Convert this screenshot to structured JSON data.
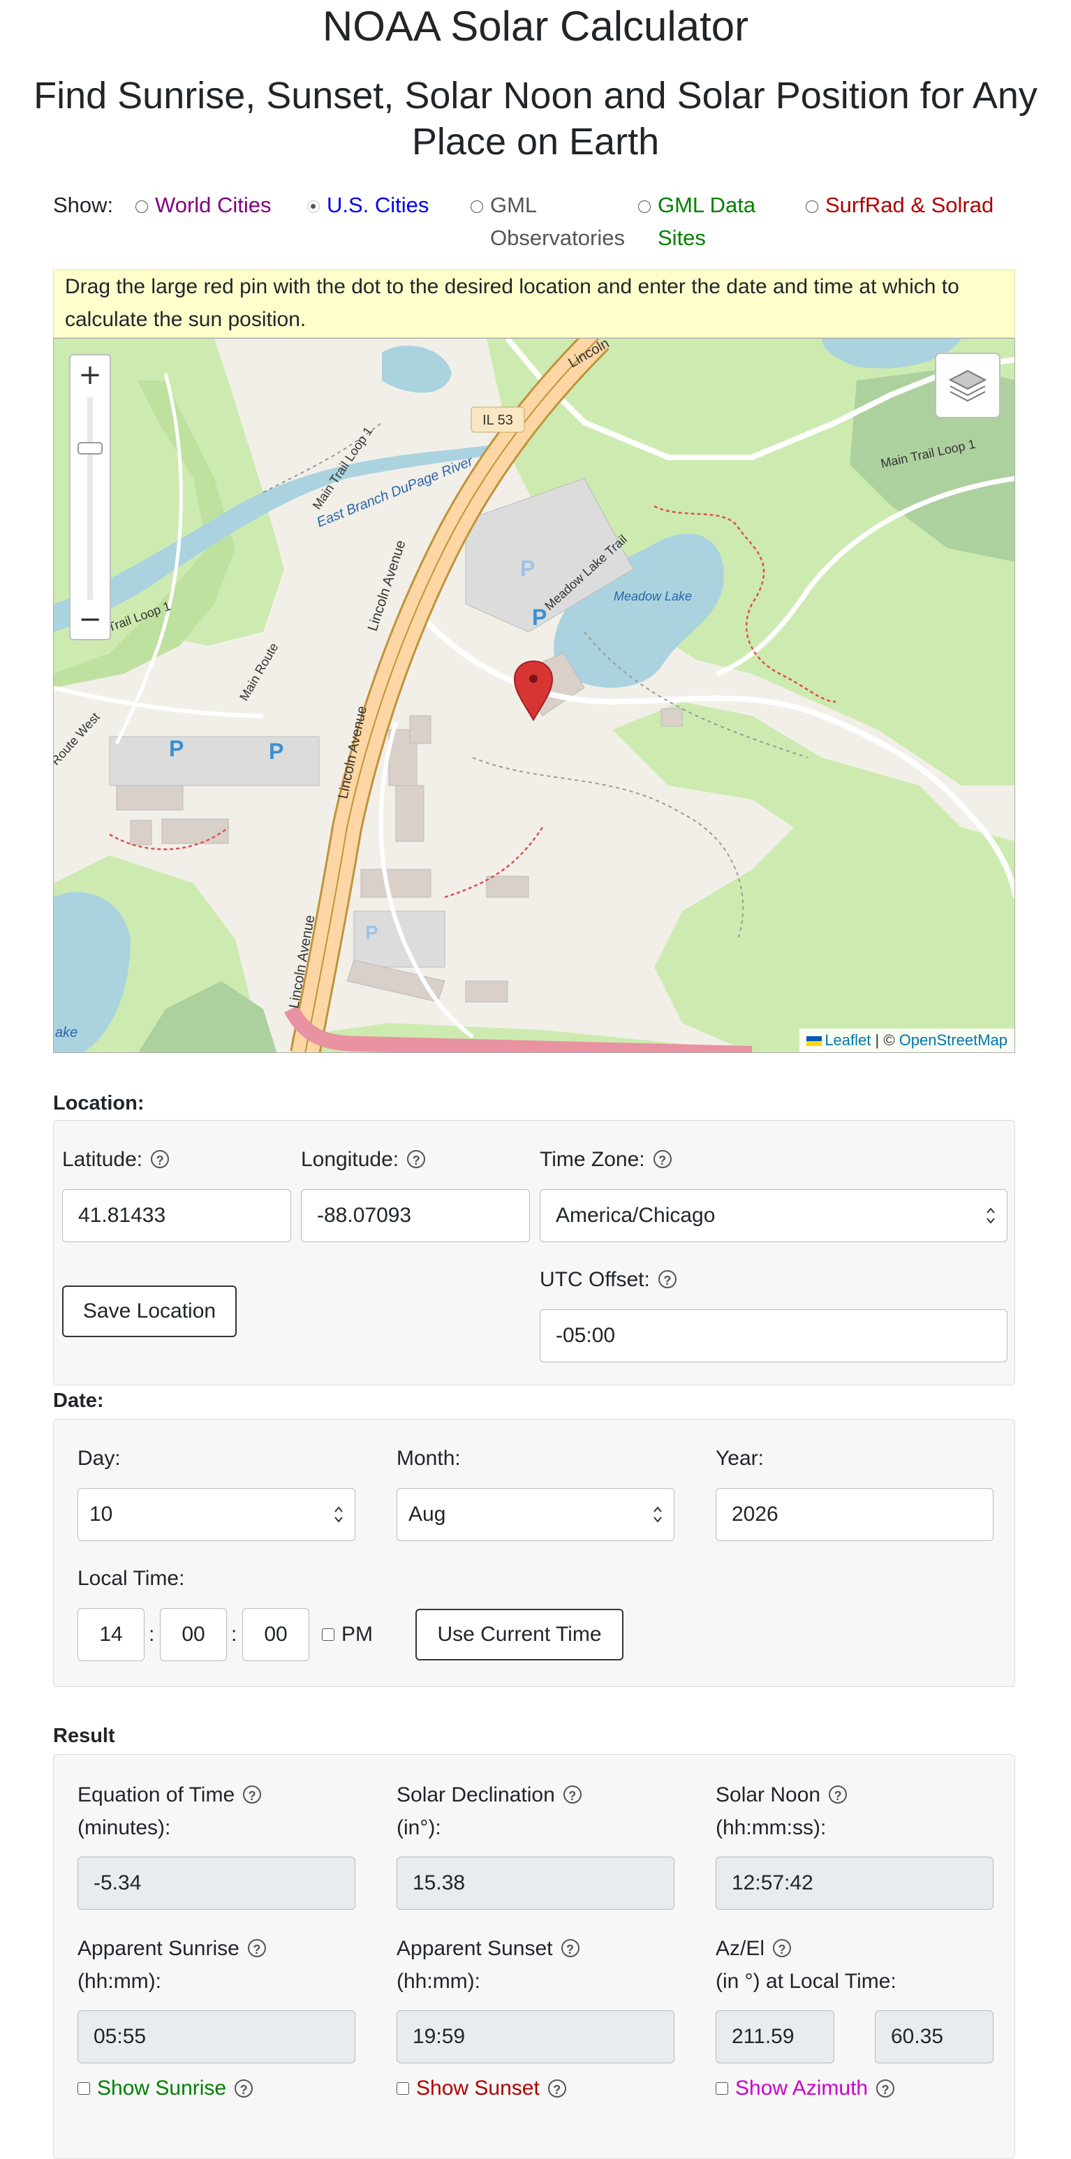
{
  "header": {
    "title": "NOAA Solar Calculator",
    "subtitle": "Find Sunrise, Sunset, Solar Noon and Solar Position for Any Place on Earth"
  },
  "show": {
    "label": "Show:",
    "options": [
      {
        "label": "World Cities",
        "color": "#800080",
        "selected": false
      },
      {
        "label": "U.S. Cities",
        "color": "#0000ee",
        "selected": true
      },
      {
        "label": "GML Observatories",
        "color": "#555555",
        "selected": false
      },
      {
        "label": "GML Data Sites",
        "color": "#008000",
        "selected": false
      },
      {
        "label": "SurfRad & Solrad",
        "color": "#b00000",
        "selected": false
      }
    ]
  },
  "instructions": "Drag the large red pin with the dot to the desired location and enter the date and time at which to calculate the sun position.",
  "map": {
    "zoom_in": "+",
    "zoom_out": "−",
    "labels": {
      "il53": "IL 53",
      "lincoln_ave": "Lincoln Avenue",
      "main_trail_loop": "Main Trail Loop 1",
      "east_branch": "East Branch DuPage River",
      "meadow_lake_trail": "Meadow Lake Trail",
      "meadow_lake": "Meadow Lake",
      "main_route": "Main Route",
      "route_west": "Route West",
      "trail_loop_1": "Trail Loop 1",
      "lake": "ake",
      "parking": "P",
      "lincoln_top": "Lincoln"
    },
    "attribution": {
      "leaflet": "Leaflet",
      "sep": "|",
      "copyright": "©",
      "osm": "OpenStreetMap"
    }
  },
  "location": {
    "heading": "Location:",
    "latitude_label": "Latitude:",
    "latitude": "41.81433",
    "longitude_label": "Longitude:",
    "longitude": "-88.07093",
    "timezone_label": "Time Zone:",
    "timezone": "America/Chicago",
    "save_button": "Save Location",
    "utc_label": "UTC Offset:",
    "utc_offset": "-05:00"
  },
  "date": {
    "heading": "Date:",
    "day_label": "Day:",
    "day": "10",
    "month_label": "Month:",
    "month": "Aug",
    "year_label": "Year:",
    "year": "2026",
    "time_label": "Local Time:",
    "hour": "14",
    "minute": "00",
    "second": "00",
    "colon": ":",
    "pm_label": "PM",
    "current_time_button": "Use Current Time"
  },
  "result": {
    "heading": "Result",
    "eot_label_1": "Equation of Time",
    "eot_label_2": "(minutes):",
    "eot": "-5.34",
    "decl_label_1": "Solar Declination",
    "decl_label_2": "(in°):",
    "decl": "15.38",
    "noon_label_1": "Solar Noon",
    "noon_label_2": "(hh:mm:ss):",
    "noon": "12:57:42",
    "sunrise_label_1": "Apparent Sunrise",
    "sunrise_label_2": "(hh:mm):",
    "sunrise": "05:55",
    "sunset_label_1": "Apparent Sunset",
    "sunset_label_2": "(hh:mm):",
    "sunset": "19:59",
    "azel_label_1": "Az/El",
    "azel_label_2": "(in °) at Local Time:",
    "azimuth": "211.59",
    "elevation": "60.35",
    "show_sunrise": "Show Sunrise",
    "show_sunset": "Show Sunset",
    "show_azimuth": "Show Azimuth",
    "colors": {
      "sunrise": "#008000",
      "sunset": "#b00000",
      "azimuth": "#cc00cc"
    }
  }
}
